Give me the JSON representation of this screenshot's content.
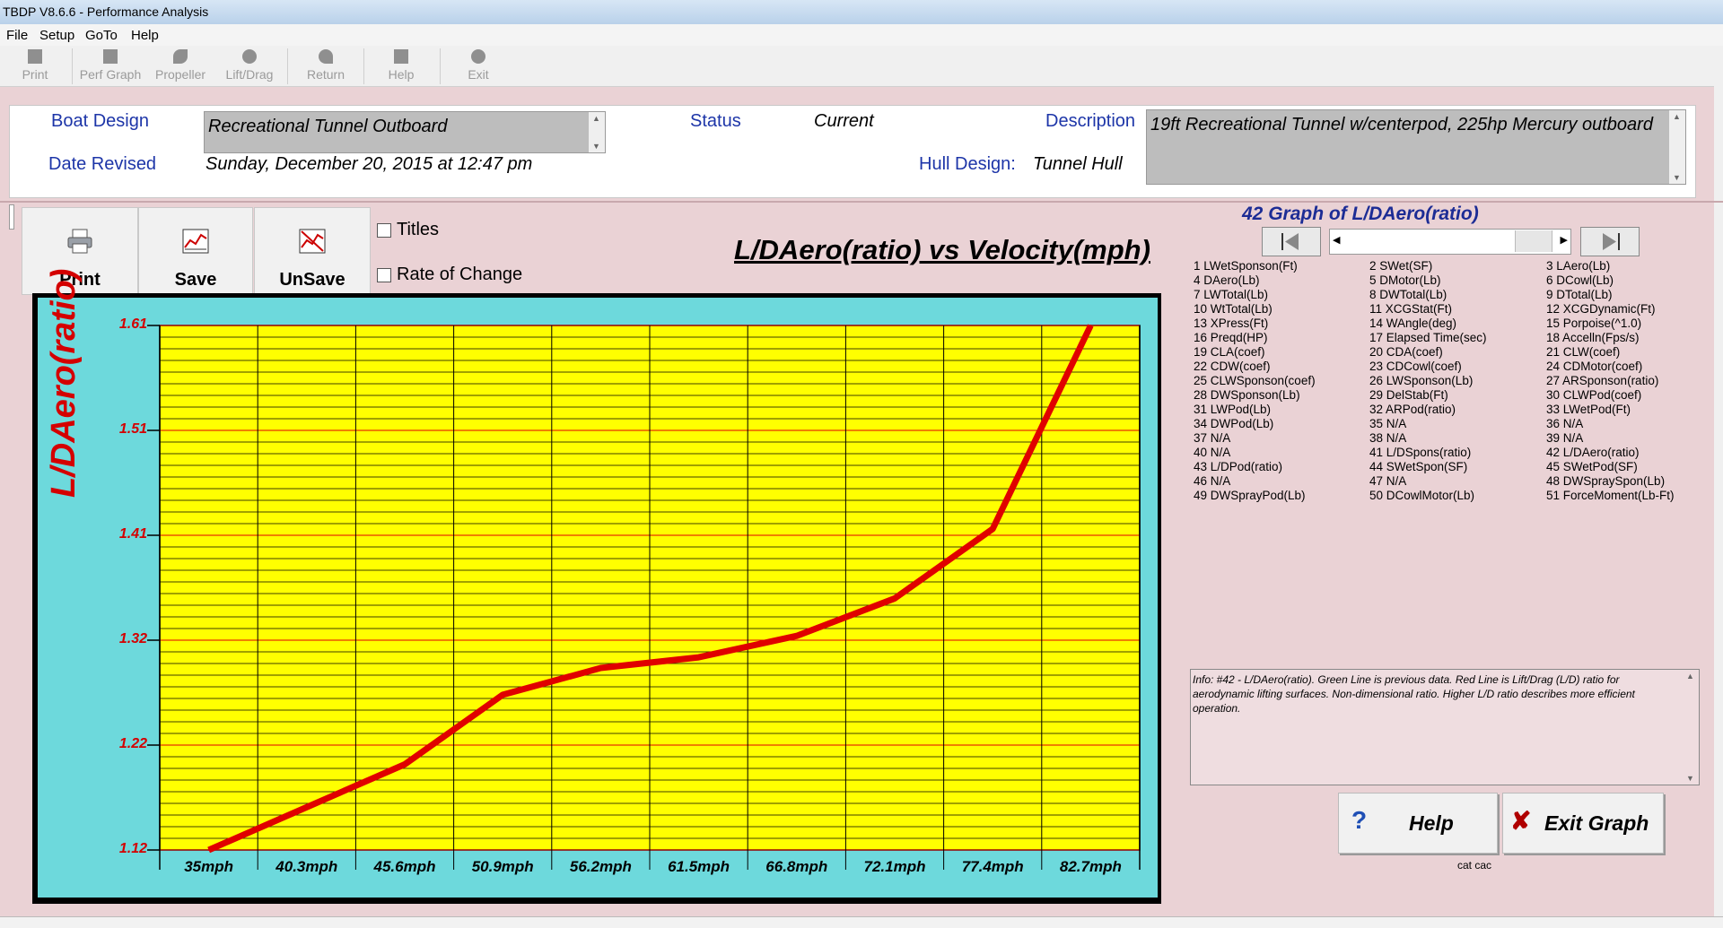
{
  "window": {
    "title": "TBDP V8.6.6 - Performance Analysis"
  },
  "menu": [
    "File",
    "Setup",
    "GoTo",
    "Help"
  ],
  "toolbar": [
    {
      "label": "Print",
      "icon": "printer-icon"
    },
    {
      "label": "Perf Graph",
      "icon": "graph-icon"
    },
    {
      "label": "Propeller",
      "icon": "propeller-icon"
    },
    {
      "label": "Lift/Drag",
      "icon": "lift-drag-icon"
    },
    {
      "label": "Return",
      "icon": "return-icon"
    },
    {
      "label": "Help",
      "icon": "help-icon"
    },
    {
      "label": "Exit",
      "icon": "exit-icon"
    }
  ],
  "header": {
    "boat_design_label": "Boat Design",
    "boat_design_value": "Recreational Tunnel Outboard",
    "date_revised_label": "Date Revised",
    "date_revised_value": "Sunday, December 20, 2015 at 12:47 pm",
    "status_label": "Status",
    "status_value": "Current",
    "hull_design_label": "Hull Design:",
    "hull_design_value": "Tunnel Hull",
    "description_label": "Description",
    "description_value": "19ft Recreational Tunnel w/centerpod, 225hp Mercury outboard"
  },
  "graph_buttons": {
    "print": "Print",
    "save": "Save",
    "unsave": "UnSave"
  },
  "options": {
    "titles": "Titles",
    "rate_of_change": "Rate of Change"
  },
  "graph_title": "L/DAero(ratio) vs Velocity(mph)",
  "graph_of": "42 Graph of L/DAero(ratio)",
  "chart_data": {
    "type": "line",
    "title": "L/DAero(ratio) vs Velocity(mph)",
    "xlabel": "",
    "ylabel": "L/DAero(ratio)",
    "categories": [
      "35mph",
      "40.3mph",
      "45.6mph",
      "50.9mph",
      "56.2mph",
      "61.5mph",
      "66.8mph",
      "72.1mph",
      "77.4mph",
      "82.7mph"
    ],
    "y_ticks": [
      "1.61",
      "1.51",
      "1.41",
      "1.32",
      "1.22",
      "1.12"
    ],
    "ylim": [
      1.12,
      1.61
    ],
    "series": [
      {
        "name": "",
        "color": "#e00000",
        "values": [
          1.12,
          1.16,
          1.2,
          1.265,
          1.29,
          1.3,
          1.32,
          1.355,
          1.42,
          1.61
        ]
      }
    ],
    "grid": true,
    "colors": {
      "plot_bg": "#ffff00",
      "outer_bg": "#6dd9dc",
      "line": "#e00000",
      "tick_labels": "#d40000"
    }
  },
  "params_col1": [
    "1 LWetSponson(Ft)",
    "4 DAero(Lb)",
    "7 LWTotal(Lb)",
    "10 WtTotal(Lb)",
    "13 XPress(Ft)",
    "16 Preqd(HP)",
    "19 CLA(coef)",
    "22 CDW(coef)",
    "25 CLWSponson(coef)",
    "28 DWSponson(Lb)",
    "31 LWPod(Lb)",
    "34 DWPod(Lb)",
    "37 N/A",
    "40 N/A",
    "43 L/DPod(ratio)",
    "46 N/A",
    "49 DWSprayPod(Lb)"
  ],
  "params_col2": [
    "2 SWet(SF)",
    "5 DMotor(Lb)",
    "8 DWTotal(Lb)",
    "11 XCGStat(Ft)",
    "14 WAngle(deg)",
    "17 Elapsed Time(sec)",
    "20 CDA(coef)",
    "23 CDCowl(coef)",
    "26 LWSponson(Lb)",
    "29 DelStab(Ft)",
    "32 ARPod(ratio)",
    "35 N/A",
    "38 N/A",
    "41 L/DSpons(ratio)",
    "44 SWetSpon(SF)",
    "47 N/A",
    "50 DCowlMotor(Lb)"
  ],
  "params_col3": [
    "3 LAero(Lb)",
    "6 DCowl(Lb)",
    "9 DTotal(Lb)",
    "12 XCGDynamic(Ft)",
    "15 Porpoise(^1.0)",
    "18 Accelln(Fps/s)",
    "21 CLW(coef)",
    "24 CDMotor(coef)",
    "27 ARSponson(ratio)",
    "30 CLWPod(coef)",
    "33 LWetPod(Ft)",
    "36 N/A",
    "39 N/A",
    "42 L/DAero(ratio)",
    "45 SWetPod(SF)",
    "48 DWSpraySpon(Lb)",
    "51 ForceMoment(Lb-Ft)"
  ],
  "info": "Info: #42 - L/DAero(ratio). Green Line is previous data. Red Line is Lift/Drag (L/D) ratio for aerodynamic lifting surfaces.  Non-dimensional ratio.  Higher L/D ratio describes more efficient operation.",
  "actions": {
    "help": "Help",
    "exit": "Exit Graph"
  },
  "footer_note": "cat cac"
}
